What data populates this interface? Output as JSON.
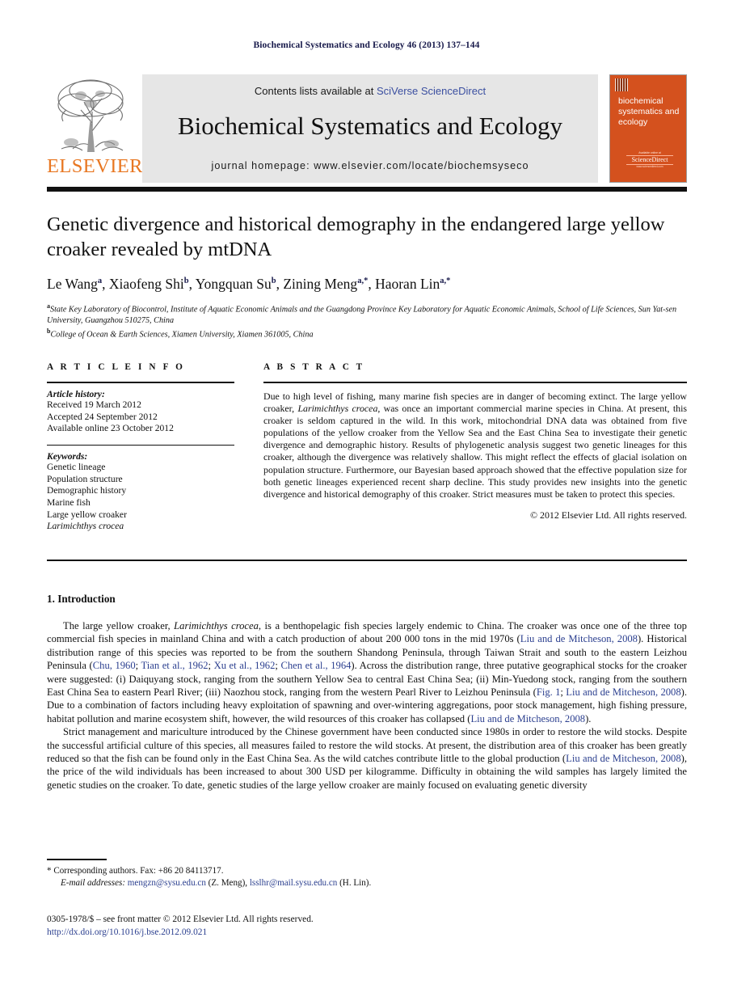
{
  "running_head": "Biochemical Systematics and Ecology 46 (2013) 137–144",
  "masthead": {
    "publisher_name": "ELSEVIER",
    "publisher_logo": "elsevier-tree-logo",
    "contents_prefix": "Contents lists available at ",
    "contents_link": "SciVerse ScienceDirect",
    "journal_title": "Biochemical Systematics and Ecology",
    "homepage_line": "journal homepage: www.elsevier.com/locate/biochemsyseco",
    "cover": {
      "title": "biochemical systematics and ecology",
      "badge_top": "Available online at",
      "badge_mid": "ScienceDirect",
      "badge_bottom": "www.sciencedirect.com",
      "accent_color": "#d4511e"
    }
  },
  "article": {
    "title": "Genetic divergence and historical demography in the endangered large yellow croaker revealed by mtDNA",
    "authors": [
      {
        "name": "Le Wang",
        "sup": "a",
        "sep": ", "
      },
      {
        "name": "Xiaofeng Shi",
        "sup": "b",
        "sep": ", "
      },
      {
        "name": "Yongquan Su",
        "sup": "b",
        "sep": ", "
      },
      {
        "name": "Zining Meng",
        "sup": "a,*",
        "sep": ", "
      },
      {
        "name": "Haoran Lin",
        "sup": "a,*",
        "sep": ""
      }
    ],
    "affiliations": [
      {
        "sup": "a",
        "text": "State Key Laboratory of Biocontrol, Institute of Aquatic Economic Animals and the Guangdong Province Key Laboratory for Aquatic Economic Animals, School of Life Sciences, Sun Yat-sen University, Guangzhou 510275, China"
      },
      {
        "sup": "b",
        "text": "College of Ocean & Earth Sciences, Xiamen University, Xiamen 361005, China"
      }
    ]
  },
  "article_info": {
    "heading": "A R T I C L E   I N F O",
    "history_label": "Article history:",
    "history": [
      "Received 19 March 2012",
      "Accepted 24 September 2012",
      "Available online 23 October 2012"
    ],
    "keywords_label": "Keywords:",
    "keywords": [
      "Genetic lineage",
      "Population structure",
      "Demographic history",
      "Marine fish",
      "Large yellow croaker"
    ],
    "keyword_italic": "Larimichthys crocea"
  },
  "abstract": {
    "heading": "A B S T R A C T",
    "part1": "Due to high level of fishing, many marine fish species are in danger of becoming extinct. The large yellow croaker, ",
    "species1": "Larimichthys crocea",
    "part2": ", was once an important commercial marine species in China. At present, this croaker is seldom captured in the wild. In this work, mitochondrial DNA data was obtained from five populations of the yellow croaker from the Yellow Sea and the East China Sea to investigate their genetic divergence and demographic history. Results of phylogenetic analysis suggest two genetic lineages for this croaker, although the divergence was relatively shallow. This might reflect the effects of glacial isolation on population structure. Furthermore, our Bayesian based approach showed that the effective population size for both genetic lineages experienced recent sharp decline. This study provides new insights into the genetic divergence and historical demography of this croaker. Strict measures must be taken to protect this species.",
    "copyright": "© 2012 Elsevier Ltd. All rights reserved."
  },
  "introduction": {
    "heading": "1. Introduction",
    "p1_a": "The large yellow croaker, ",
    "p1_species": "Larimichthys crocea",
    "p1_b": ", is a benthopelagic fish species largely endemic to China. The croaker was once one of the three top commercial fish species in mainland China and with a catch production of about 200 000 tons in the mid 1970s (",
    "p1_ref1": "Liu and de Mitcheson, 2008",
    "p1_c": "). Historical distribution range of this species was reported to be from the southern Shandong Peninsula, through Taiwan Strait and south to the eastern Leizhou Peninsula (",
    "p1_ref2": "Chu, 1960",
    "p1_d": "; ",
    "p1_ref3": "Tian et al., 1962",
    "p1_e": "; ",
    "p1_ref4": "Xu et al., 1962",
    "p1_f": "; ",
    "p1_ref5": "Chen et al., 1964",
    "p1_g": "). Across the distribution range, three putative geographical stocks for the croaker were suggested: (i) Daiquyang stock, ranging from the southern Yellow Sea to central East China Sea; (ii) Min-Yuedong stock, ranging from the southern East China Sea to eastern Pearl River; (iii) Naozhou stock, ranging from the western Pearl River to Leizhou Peninsula (",
    "p1_ref6": "Fig. 1",
    "p1_h": "; ",
    "p1_ref7": "Liu and de Mitcheson, 2008",
    "p1_i": "). Due to a combination of factors including heavy exploitation of spawning and over-wintering aggregations, poor stock management, high fishing pressure, habitat pollution and marine ecosystem shift, however, the wild resources of this croaker has collapsed (",
    "p1_ref8": "Liu and de Mitcheson, 2008",
    "p1_j": ").",
    "p2_a": "Strict management and mariculture introduced by the Chinese government have been conducted since 1980s in order to restore the wild stocks. Despite the successful artificial culture of this species, all measures failed to restore the wild stocks. At present, the distribution area of this croaker has been greatly reduced so that the fish can be found only in the East China Sea. As the wild catches contribute little to the global production (",
    "p2_ref1": "Liu and de Mitcheson, 2008",
    "p2_b": "), the price of the wild individuals has been increased to about 300 USD per kilogramme. Difficulty in obtaining the wild samples has largely limited the genetic studies on the croaker. To date, genetic studies of the large yellow croaker are mainly focused on evaluating genetic diversity"
  },
  "footnote": {
    "corresponding": "* Corresponding authors. Fax: +86 20 84113717.",
    "email_label": "E-mail addresses:",
    "email1": "mengzn@sysu.edu.cn",
    "email1_owner": " (Z. Meng), ",
    "email2": "lsslhr@mail.sysu.edu.cn",
    "email2_owner": " (H. Lin)."
  },
  "footer": {
    "issn_line": "0305-1978/$ – see front matter © 2012 Elsevier Ltd. All rights reserved.",
    "doi": "http://dx.doi.org/10.1016/j.bse.2012.09.021"
  }
}
